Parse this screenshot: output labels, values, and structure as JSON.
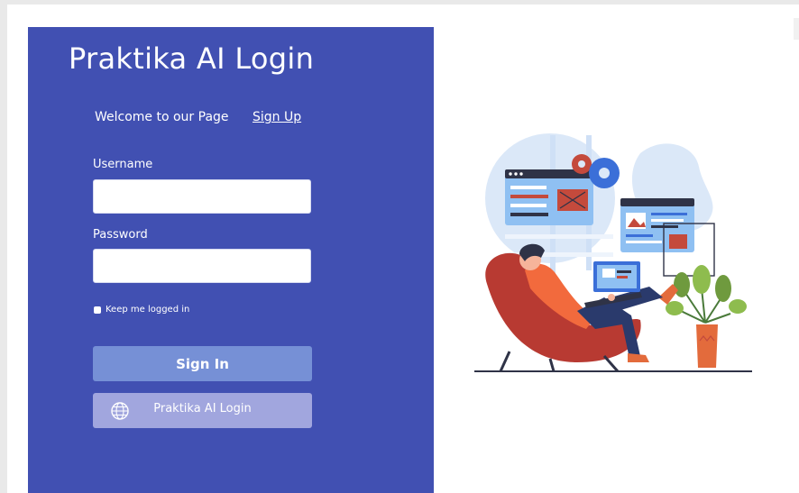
{
  "login": {
    "title": "Praktika AI Login",
    "welcome": "Welcome to our Page",
    "signup_link": "Sign Up",
    "username_label": "Username",
    "username_value": "",
    "password_label": "Password",
    "password_value": "",
    "remember_label": "Keep me logged in",
    "signin_button": "Sign In",
    "ai_button": "Praktika AI Login"
  },
  "icons": {
    "ai_button_icon": "globe-icon",
    "illustration": "person-with-laptop-illustration"
  },
  "colors": {
    "panel": "#4150b2",
    "signin": "#7690d6",
    "ai_button": "#a1a6de"
  }
}
